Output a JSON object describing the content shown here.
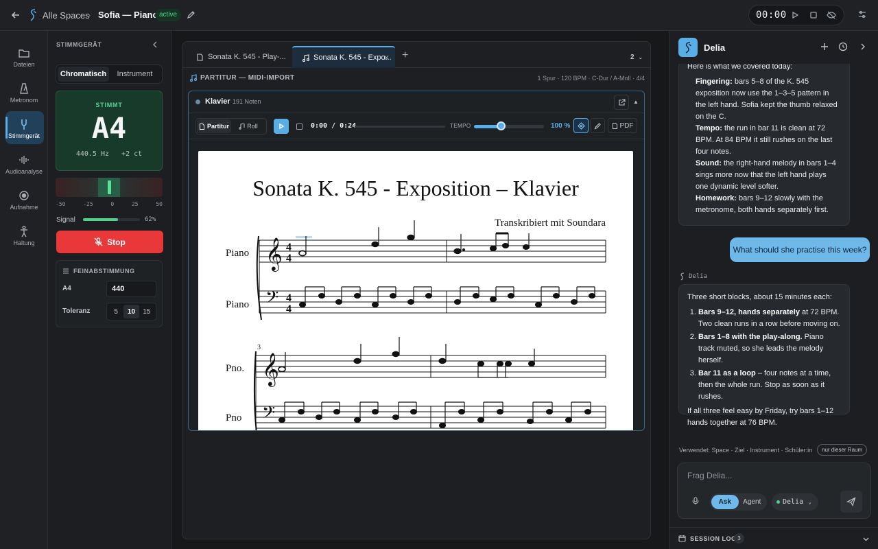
{
  "topbar": {
    "crumb": "Alle Spaces",
    "separator": "›",
    "space_title": "Sofia — Piano",
    "status_badge": "active",
    "timer": "00:00"
  },
  "rail": [
    {
      "label": "Dateien",
      "icon": "folder-icon"
    },
    {
      "label": "Metronom",
      "icon": "metronome-icon"
    },
    {
      "label": "Stimmgerät",
      "icon": "tuning-fork-icon",
      "active": true
    },
    {
      "label": "Audioanalyse",
      "icon": "waveform-icon"
    },
    {
      "label": "Aufnahme",
      "icon": "record-icon"
    },
    {
      "label": "Haltung",
      "icon": "posture-icon"
    }
  ],
  "tuner": {
    "heading": "STIMMGERÄT",
    "modes": [
      "Chromatisch",
      "Instrument"
    ],
    "status": "STIMMT",
    "note": "A4",
    "frequency": "440.5 Hz",
    "cents": "+2 ct",
    "scale": [
      "-50",
      "-25",
      "0",
      "25",
      "50"
    ],
    "signal_label": "Signal",
    "signal_percent": "62%",
    "signal_level": 0.62,
    "stop_label": "Stop",
    "fine_heading": "FEINABSTIMMUNG",
    "a4_label": "A4",
    "a4_value": "440",
    "tolerance_label": "Toleranz",
    "tolerance_options": [
      "5",
      "10",
      "15"
    ],
    "tolerance_selected": "10"
  },
  "doc": {
    "tabs": [
      {
        "label": "Sonata K. 545 - Play-...",
        "icon": "file-icon"
      },
      {
        "label": "Sonata K. 545 - Expo...",
        "icon": "music-note-icon",
        "active": true
      }
    ],
    "tab_count": "2",
    "subhead": "PARTITUR — MIDI-IMPORT",
    "meta": "1 Spur · 120 BPM · C-Dur / A-Moll · 4/4",
    "track_name": "Klavier",
    "track_count": "191 Noten",
    "view_modes": [
      "Partitur",
      "Roll"
    ],
    "time": "0:00 / 0:24",
    "tempo_label": "TEMPO",
    "tempo_value": "100 %",
    "tempo_level": 0.38,
    "pdf_label": "PDF",
    "score_title": "Sonata K. 545 - Exposition – Klavier",
    "score_subtitle": "Transkribiert mit Soundara",
    "staff_labels": [
      "Piano",
      "Piano",
      "Pno.",
      "Pno"
    ],
    "measure_number": "3"
  },
  "assistant": {
    "name": "Delia",
    "msg1_intro": "Here is what we covered today:",
    "msg1_items": [
      {
        "label": "Fingering:",
        "text": " bars 5–8 of the K. 545 exposition now use the 1–3–5 pattern in the left hand. Sofia kept the thumb relaxed on the C."
      },
      {
        "label": "Tempo:",
        "text": " the run in bar 11 is clean at 72 BPM. At 84 BPM it still rushes on the last four notes."
      },
      {
        "label": "Sound:",
        "text": " the right-hand melody in bars 1–4 sings more now that the left hand plays one dynamic level softer."
      },
      {
        "label": "Homework:",
        "text": " bars 9–12 slowly with the metronome, both hands separately first."
      }
    ],
    "user_msg": "What should she practise this week?",
    "sender": "Delia",
    "msg2_intro": "Three short blocks, about 15 minutes each:",
    "msg2_items": [
      {
        "label": "Bars 9–12, hands separately",
        "text": " at 72 BPM. Two clean runs in a row before moving on."
      },
      {
        "label": "Bars 1–8 with the play-along.",
        "text": " Piano track muted, so she leads the melody herself."
      },
      {
        "label": "Bar 11 as a loop",
        "text": " – four notes at a time, then the whole run. Stop as soon as it rushes."
      }
    ],
    "msg2_outro": "If all three feel easy by Friday, try bars 1–12 hands together at 76 BPM.",
    "used": "Verwendet: Space · Ziel · Instrument · Schüler:in",
    "room_pill": "nur dieser Raum",
    "placeholder": "Frag Delia...",
    "modes": [
      "Ask",
      "Agent"
    ],
    "model": "Delia",
    "session_log": "SESSION LOG",
    "session_count": "3"
  }
}
